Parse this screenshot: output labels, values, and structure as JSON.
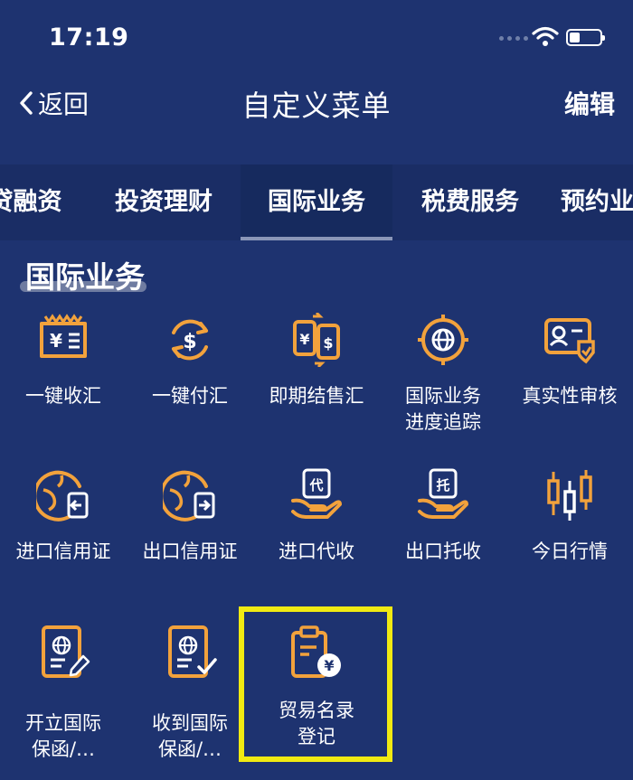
{
  "status": {
    "time": "17:19"
  },
  "nav": {
    "back_label": "返回",
    "title": "自定义菜单",
    "edit_label": "编辑"
  },
  "tabs": [
    {
      "label": "贷融资"
    },
    {
      "label": "投资理财"
    },
    {
      "label": "国际业务",
      "active": true
    },
    {
      "label": "税费服务"
    },
    {
      "label": "预约业"
    }
  ],
  "section": {
    "title": "国际业务"
  },
  "items": [
    {
      "label1": "一键收汇",
      "label2": "",
      "icon": "yuan-receipt-icon"
    },
    {
      "label1": "一键付汇",
      "label2": "",
      "icon": "dollar-cycle-icon"
    },
    {
      "label1": "即期结售汇",
      "label2": "",
      "icon": "currency-exchange-icon"
    },
    {
      "label1": "国际业务",
      "label2": "进度追踪",
      "icon": "globe-target-icon"
    },
    {
      "label1": "真实性审核",
      "label2": "",
      "icon": "id-card-check-icon"
    },
    {
      "label1": "进口信用证",
      "label2": "",
      "icon": "globe-import-icon"
    },
    {
      "label1": "出口信用证",
      "label2": "",
      "icon": "globe-export-icon"
    },
    {
      "label1": "进口代收",
      "label2": "",
      "icon": "hand-dai-icon"
    },
    {
      "label1": "出口托收",
      "label2": "",
      "icon": "hand-tuo-icon"
    },
    {
      "label1": "今日行情",
      "label2": "",
      "icon": "candlestick-icon"
    },
    {
      "label1": "开立国际",
      "label2": "保函/…",
      "icon": "passport-pen-icon"
    },
    {
      "label1": "收到国际",
      "label2": "保函/…",
      "icon": "passport-check-icon"
    },
    {
      "label1": "贸易名录",
      "label2": "登记",
      "icon": "clipboard-yuan-icon"
    }
  ],
  "colors": {
    "background": "#1e3370",
    "accent": "#f2a23c",
    "highlight": "#f1ea12"
  }
}
